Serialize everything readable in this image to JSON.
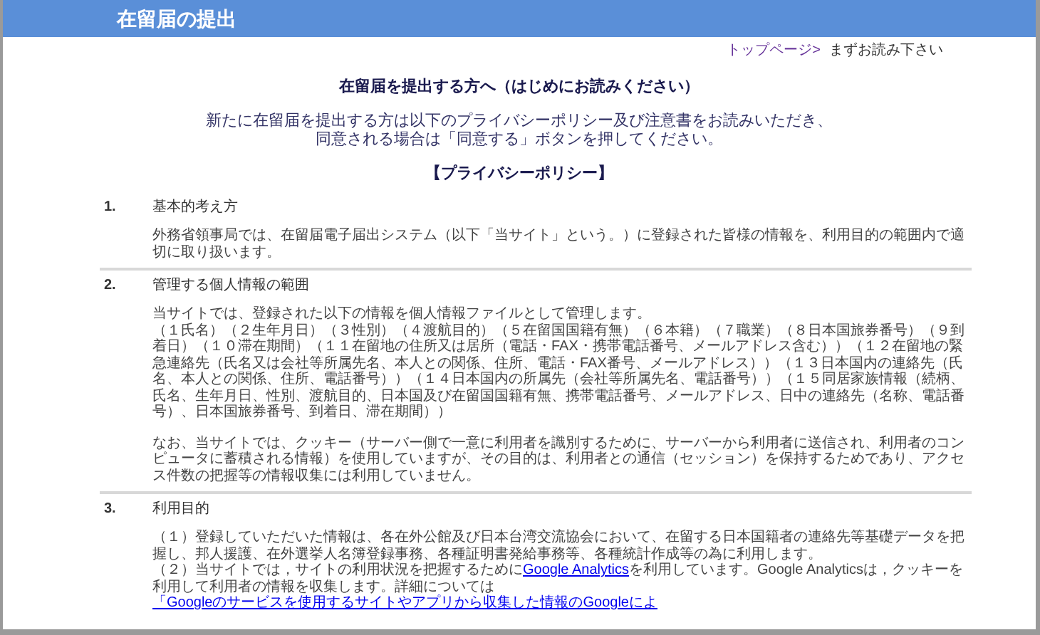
{
  "header": {
    "title": "在留届の提出"
  },
  "breadcrumb": [
    {
      "label": "トップページ>",
      "link": true
    },
    {
      "label": "まずお読み下さい",
      "link": false
    }
  ],
  "heading": "在留届を提出する方へ（はじめにお読みください）",
  "intro": [
    "新たに在留届を提出する方は以下のプライバシーポリシー及び注意書をお読みいただき、",
    "同意される場合は「同意する」ボタンを押してください。"
  ],
  "policy_title": "【プライバシーポリシー】",
  "sections": [
    {
      "number": "1.",
      "title": "基本的考え方",
      "blocks": [
        [
          {
            "text": "外務省領事局では、在留届電子届出システム（以下「当サイト」という。）に登録された皆様の情報を、利用目的の範囲内で適切に取り扱います。"
          }
        ]
      ]
    },
    {
      "number": "2.",
      "title": "管理する個人情報の範囲",
      "blocks": [
        [
          {
            "text": "当サイトでは、登録された以下の情報を個人情報ファイルとして管理します。"
          },
          {
            "text": "（１氏名）（２生年月日）（３性別）（４渡航目的）（５在留国国籍有無）（６本籍）（７職業）（８日本国旅券番号）（９到着日）（１０滞在期間）（１１在留地の住所又は居所（電話・FAX・携帯電話番号、メールアドレス含む））（１２在留地の緊急連絡先（氏名又は会社等所属先名、本人との関係、住所、電話・FAX番号、メールアドレス））（１３日本国内の連絡先（氏名、本人との関係、住所、電話番号））（１４日本国内の所属先（会社等所属先名、電話番号））（１５同居家族情報（続柄、氏名、生年月日、性別、渡航目的、日本国及び在留国国籍有無、携帯電話番号、メールアドレス、日中の連絡先（名称、電話番号）、日本国旅券番号、到着日、滞在期間））"
          }
        ],
        [
          {
            "text": "なお、当サイトでは、クッキー（サーバー側で一意に利用者を識別するために、サーバーから利用者に送信され、利用者のコンピュータに蓄積される情報）を使用していますが、その目的は、利用者との通信（セッション）を保持するためであり、アクセス件数の把握等の情報収集には利用していません。"
          }
        ]
      ]
    },
    {
      "number": "3.",
      "title": "利用目的",
      "blocks": [
        [
          {
            "text": "（１）登録していただいた情報は、各在外公館及び日本台湾交流協会において、在留する日本国籍者の連絡先等基礎データを把握し、邦人援護、在外選挙人名簿登録事務、各種証明書発給事務等、各種統計作成等の為に利用します。"
          },
          {
            "parts": [
              {
                "text": "（２）当サイトでは，サイトの利用状況を把握するために",
                "link": false
              },
              {
                "text": "Google Analytics",
                "link": true
              },
              {
                "text": "を利用しています。Google Analyticsは，クッキーを利用して利用者の情報を収集します。詳細については",
                "link": false
              },
              {
                "text": "「Googleのサービスを使用するサイトやアプリから収集した情報のGoogleによ",
                "link": true
              }
            ]
          }
        ]
      ]
    }
  ]
}
